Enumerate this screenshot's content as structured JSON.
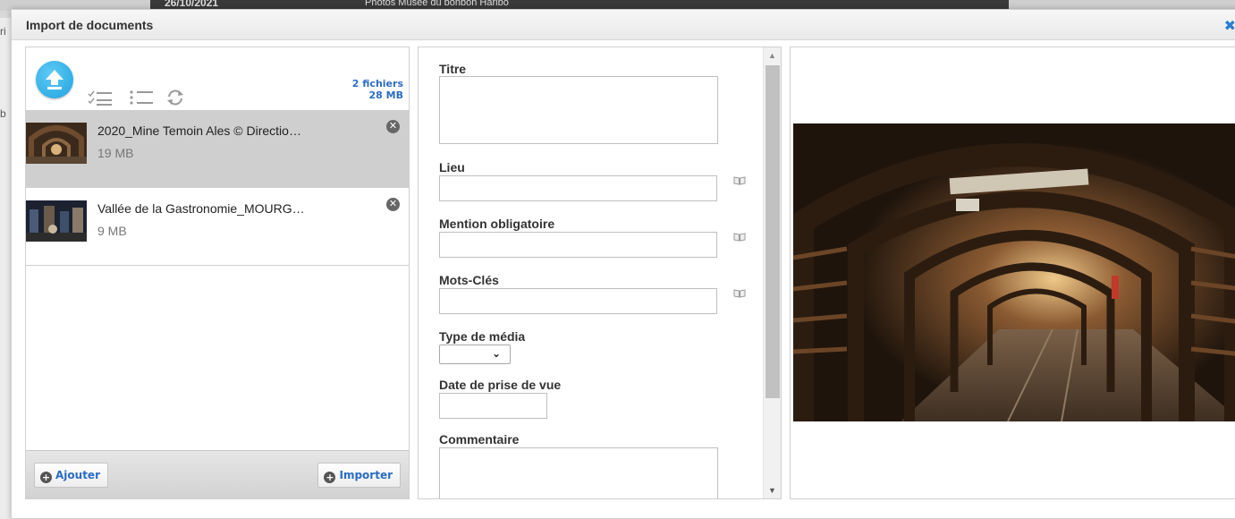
{
  "background": {
    "date_text": "26/10/2021",
    "row_text": "Photos Musée du bonbon Haribo",
    "side_letters": [
      "ri",
      "b"
    ]
  },
  "dialog": {
    "title": "Import de documents",
    "close_icon": "close-icon"
  },
  "uploader": {
    "summary": {
      "files": "2 fichiers",
      "size": "28 MB"
    },
    "tools": [
      "upload-icon",
      "check-list-icon",
      "list-icon",
      "refresh-icon"
    ],
    "files": [
      {
        "name": "2020_Mine Temoin Ales © Directio…",
        "size": "19 MB",
        "selected": true
      },
      {
        "name": "Vallée de la Gastronomie_MOURG…",
        "size": "9 MB",
        "selected": false
      }
    ],
    "footer": {
      "add_label": "Ajouter",
      "import_label": "Importer"
    }
  },
  "form": {
    "titre_label": "Titre",
    "lieu_label": "Lieu",
    "mention_label": "Mention obligatoire",
    "mots_label": "Mots-Clés",
    "type_label": "Type de média",
    "type_value": "",
    "date_label": "Date de prise de vue",
    "commentaire_label": "Commentaire"
  },
  "colors": {
    "accent": "#2b6cc4",
    "selected_row": "#cfcfcf",
    "upload_button": "#1ea3e0"
  }
}
